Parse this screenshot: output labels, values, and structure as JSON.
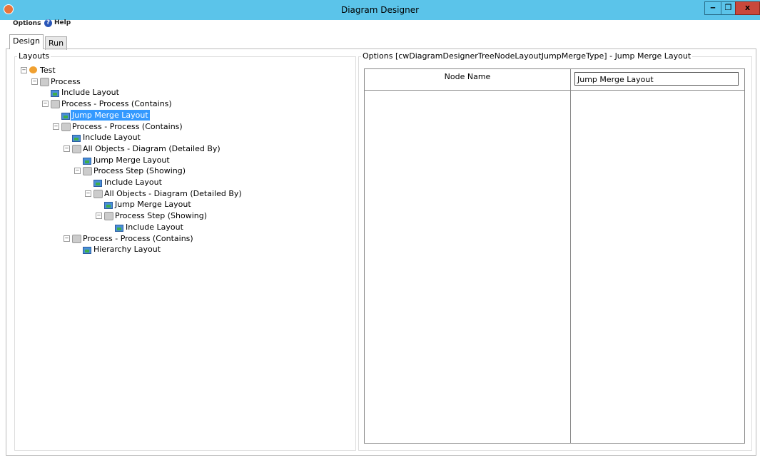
{
  "window": {
    "title": "Diagram Designer",
    "minimize": "‒",
    "restore": "❐",
    "close": "x"
  },
  "menu": {
    "options": "Options",
    "help": "Help"
  },
  "tabs": [
    {
      "label": "Design",
      "active": true
    },
    {
      "label": "Run",
      "active": false
    }
  ],
  "layouts": {
    "label": "Layouts",
    "tree": [
      {
        "label": "Test",
        "level": 0,
        "icon": "root",
        "expander": "⊟"
      },
      {
        "label": "Process",
        "level": 1,
        "icon": "cube",
        "expander": "⊟"
      },
      {
        "label": "Include Layout",
        "level": 2,
        "icon": "layout"
      },
      {
        "label": "Process - Process (Contains)",
        "level": 2,
        "icon": "cube",
        "expander": "⊟"
      },
      {
        "label": "Jump Merge Layout",
        "level": 3,
        "icon": "layout",
        "selected": true
      },
      {
        "label": "Process - Process (Contains)",
        "level": 3,
        "icon": "cube",
        "expander": "⊟"
      },
      {
        "label": "Include Layout",
        "level": 4,
        "icon": "layout"
      },
      {
        "label": "All Objects - Diagram (Detailed By)",
        "level": 4,
        "icon": "cube",
        "expander": "⊟"
      },
      {
        "label": "Jump Merge Layout",
        "level": 5,
        "icon": "layout"
      },
      {
        "label": "Process Step (Showing)",
        "level": 5,
        "icon": "cube",
        "expander": "⊟"
      },
      {
        "label": "Include Layout",
        "level": 6,
        "icon": "layout"
      },
      {
        "label": "All Objects - Diagram (Detailed By)",
        "level": 6,
        "icon": "cube",
        "expander": "⊟"
      },
      {
        "label": "Jump Merge Layout",
        "level": 7,
        "icon": "layout"
      },
      {
        "label": "Process Step (Showing)",
        "level": 7,
        "icon": "cube",
        "expander": "⊟"
      },
      {
        "label": "Include Layout",
        "level": 8,
        "icon": "layout"
      },
      {
        "label": "Process - Process (Contains)",
        "level": 4,
        "icon": "cube",
        "expander": "⊟"
      },
      {
        "label": "Hierarchy Layout",
        "level": 5,
        "icon": "layout"
      }
    ]
  },
  "options": {
    "label": "Options [cwDiagramDesignerTreeNodeLayoutJumpMergeType] - Jump Merge Layout",
    "property": "Node Name",
    "value": "Jump Merge Layout"
  }
}
